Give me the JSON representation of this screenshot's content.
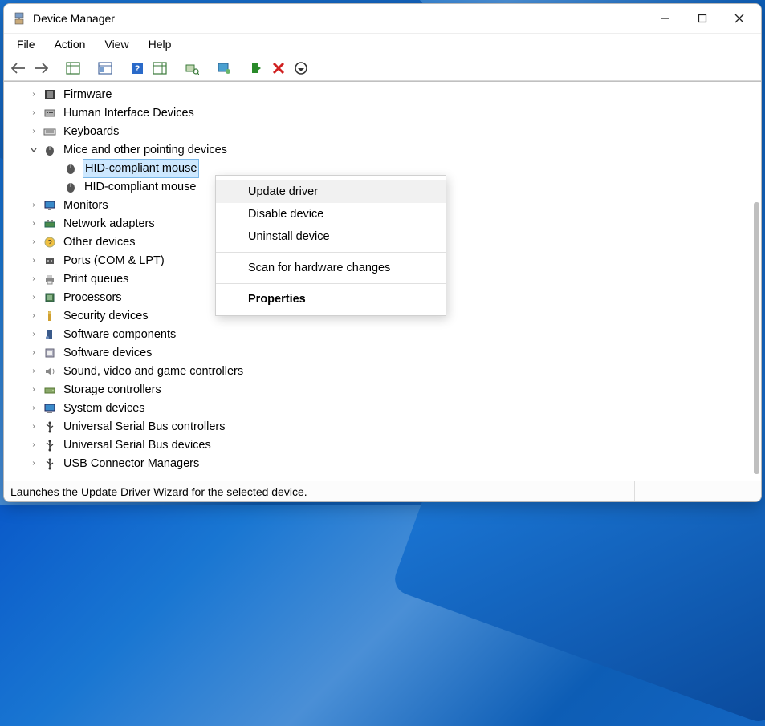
{
  "title": "Device Manager",
  "menu": {
    "file": "File",
    "action": "Action",
    "view": "View",
    "help": "Help"
  },
  "tree": {
    "firmware": "Firmware",
    "hid": "Human Interface Devices",
    "keyboards": "Keyboards",
    "mice": "Mice and other pointing devices",
    "mice_children": {
      "a": "HID-compliant mouse",
      "b": "HID-compliant mouse"
    },
    "monitors": "Monitors",
    "netadapt": "Network adapters",
    "other": "Other devices",
    "ports": "Ports (COM & LPT)",
    "printq": "Print queues",
    "proc": "Processors",
    "secdev": "Security devices",
    "softcomp": "Software components",
    "softdev": "Software devices",
    "sound": "Sound, video and game controllers",
    "storage": "Storage controllers",
    "sysdev": "System devices",
    "usbctrl": "Universal Serial Bus controllers",
    "usbdev": "Universal Serial Bus devices",
    "usbconn": "USB Connector Managers"
  },
  "context": {
    "update": "Update driver",
    "disable": "Disable device",
    "uninstall": "Uninstall device",
    "scan": "Scan for hardware changes",
    "props": "Properties"
  },
  "status": "Launches the Update Driver Wizard for the selected device."
}
